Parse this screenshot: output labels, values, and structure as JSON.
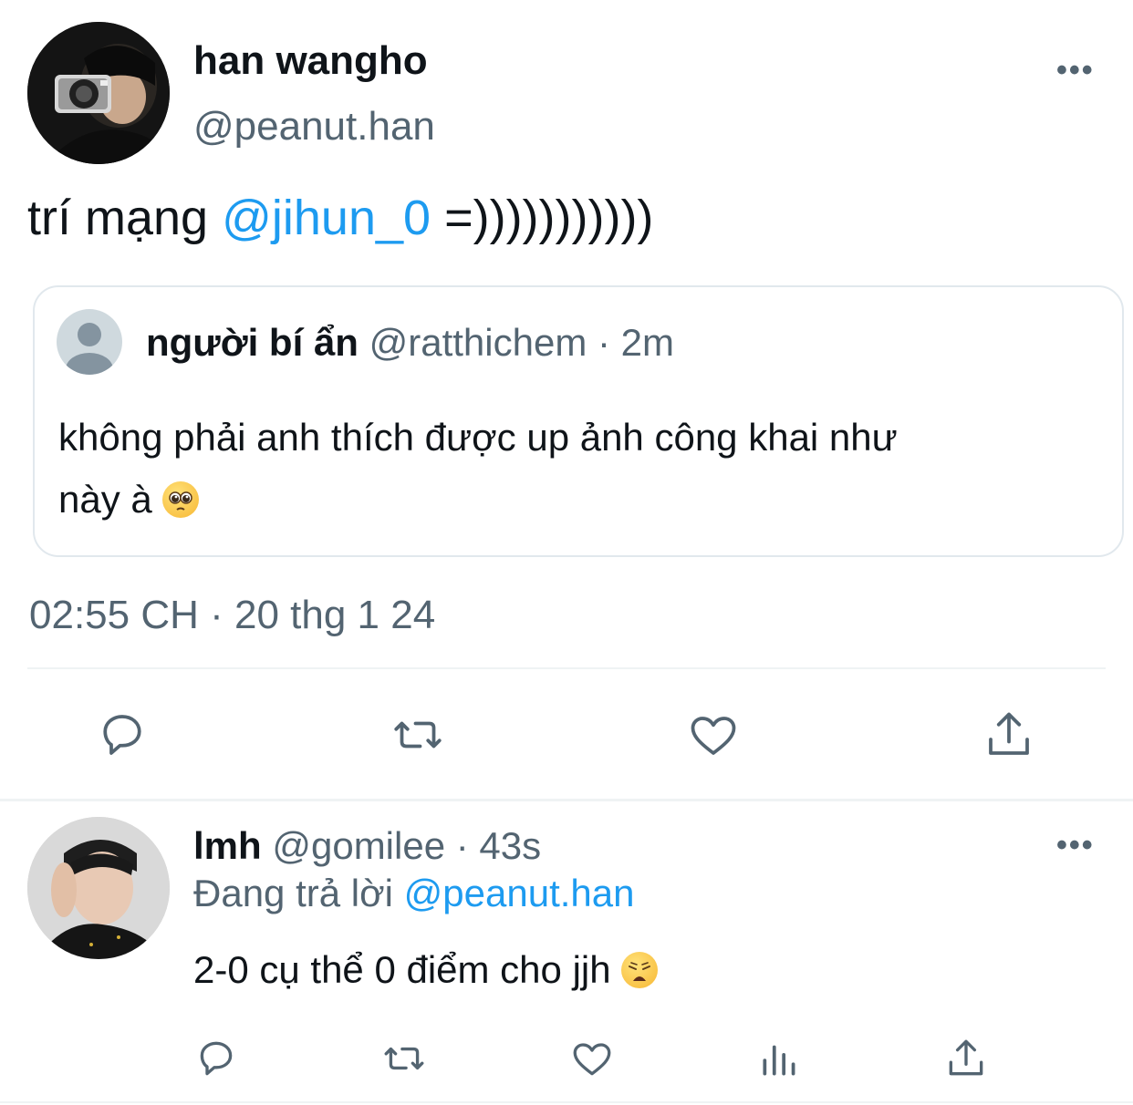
{
  "main_tweet": {
    "display_name": "han wangho",
    "handle": "@peanut.han",
    "more_label": "•••",
    "text_prefix": "trí mạng ",
    "mention": "@jihun_0",
    "text_suffix": " =)))))))))))",
    "timestamp": "02:55 CH · 20 thg 1 24",
    "avatar_icon": "profile-photo-camera"
  },
  "quoted_tweet": {
    "display_name": "người bí ẩn",
    "handle": "@ratthichem",
    "separator": "·",
    "age": "2m",
    "text_line1": "không phải anh thích được up ảnh công khai như",
    "text_line2": "này à",
    "emoji": "pleading-face-emoji",
    "avatar_icon": "default-avatar-icon"
  },
  "actions": {
    "reply_icon": "reply-icon",
    "retweet_icon": "retweet-icon",
    "like_icon": "heart-icon",
    "share_icon": "share-icon",
    "views_icon": "views-icon"
  },
  "reply_tweet": {
    "display_name": "lmh",
    "handle": "@gomilee",
    "separator": "·",
    "age": "43s",
    "more_label": "•••",
    "replying_to_label": "Đang trả lời",
    "replying_to_handle": "@peanut.han",
    "text": "2-0 cụ thể 0 điểm cho jjh",
    "emoji": "weary-face-emoji",
    "avatar_icon": "profile-photo"
  },
  "colors": {
    "text": "#0f1419",
    "muted": "#536471",
    "link": "#1d9bf0",
    "divider": "#eff3f4"
  }
}
